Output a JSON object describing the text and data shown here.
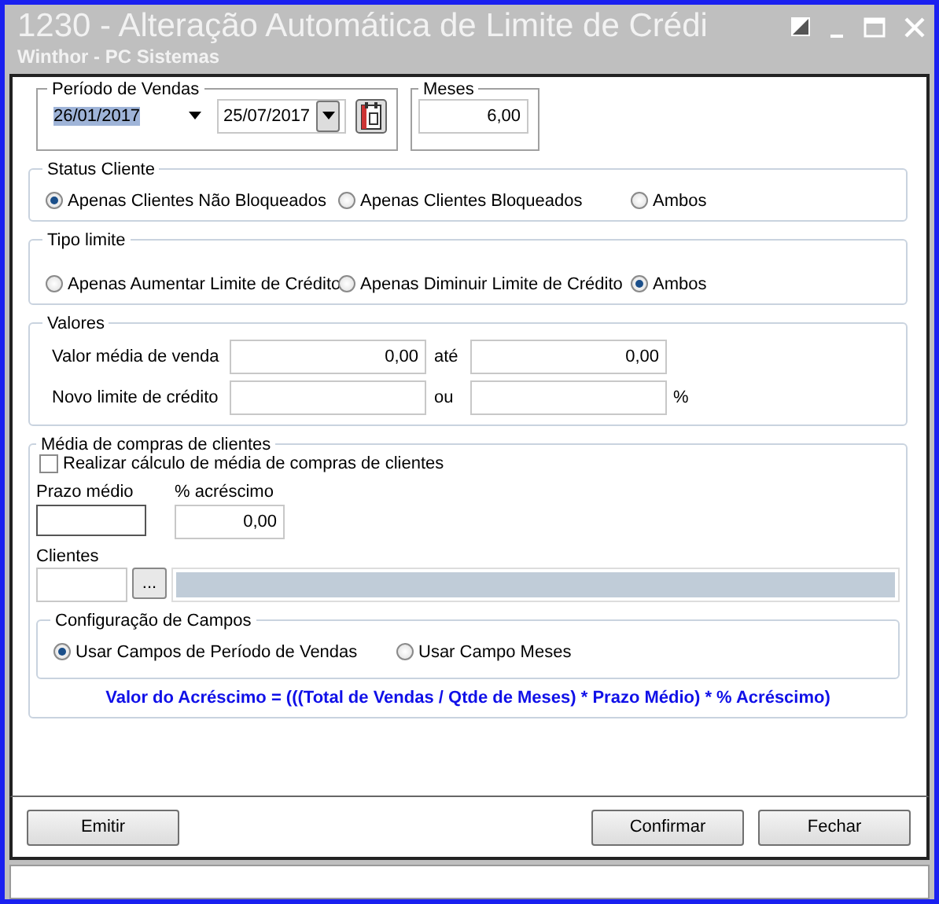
{
  "window": {
    "title": "1230 - Alteração Automática de Limite de Crédi",
    "subtitle": "Winthor - PC Sistemas"
  },
  "periodo": {
    "label": "Período de Vendas",
    "start": "26/01/2017",
    "start_highlighted": true,
    "end": "25/07/2017"
  },
  "meses": {
    "label": "Meses",
    "value": "6,00"
  },
  "status_cliente": {
    "label": "Status Cliente",
    "options": [
      {
        "label": "Apenas Clientes Não Bloqueados",
        "selected": true
      },
      {
        "label": "Apenas Clientes Bloqueados",
        "selected": false
      },
      {
        "label": "Ambos",
        "selected": false
      }
    ]
  },
  "tipo_limite": {
    "label": "Tipo limite",
    "options": [
      {
        "label": "Apenas Aumentar Limite de Crédito",
        "selected": false
      },
      {
        "label": "Apenas Diminuir Limite de Crédito",
        "selected": false
      },
      {
        "label": "Ambos",
        "selected": true
      }
    ]
  },
  "valores": {
    "label": "Valores",
    "rows": [
      {
        "label": "Valor média de venda",
        "from": "0,00",
        "sep": "até",
        "to": "0,00"
      },
      {
        "label": "Novo limite de crédito",
        "sep": "ou",
        "unit": "%"
      }
    ]
  },
  "media": {
    "label": "Média de compras de clientes",
    "checkbox": {
      "label": "Realizar cálculo de média de compras de clientes",
      "checked": false
    },
    "prazo": {
      "label": "Prazo médio"
    },
    "acrescimo": {
      "label": "% acréscimo",
      "value": "0,00"
    },
    "clientes": {
      "label": "Clientes",
      "browse": "..."
    },
    "config": {
      "label": "Configuração de Campos",
      "options": [
        {
          "label": "Usar Campos de Período de Vendas",
          "selected": true
        },
        {
          "label": "Usar Campo Meses",
          "selected": false
        }
      ]
    },
    "formula": "Valor do Acréscimo = (((Total de Vendas / Qtde de Meses) * Prazo Médio) * % Acréscimo)"
  },
  "buttons": [
    {
      "label": "Emitir",
      "kind": "left"
    },
    {
      "label": "Confirmar",
      "kind": "right"
    },
    {
      "label": "Fechar",
      "kind": "right"
    }
  ]
}
